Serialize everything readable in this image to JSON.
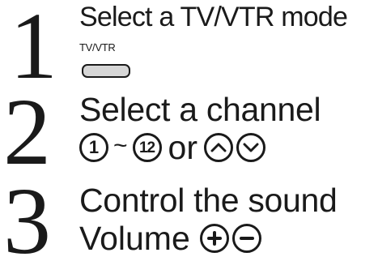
{
  "steps": [
    {
      "number": "1",
      "heading": "Select a TV/VTR mode",
      "button_label": "TV/VTR"
    },
    {
      "number": "2",
      "heading": "Select a channel",
      "channel_from": "1",
      "range_separator": "~",
      "channel_to": "12",
      "or_text": "or"
    },
    {
      "number": "3",
      "heading": "Control the sound",
      "volume_label": "Volume"
    }
  ],
  "icons": {
    "channel_up": "chevron-up-icon",
    "channel_down": "chevron-down-icon",
    "volume_up": "plus-icon",
    "volume_down": "minus-icon"
  },
  "colors": {
    "text": "#1a1a1a",
    "button_fill": "#d6d6d6"
  }
}
